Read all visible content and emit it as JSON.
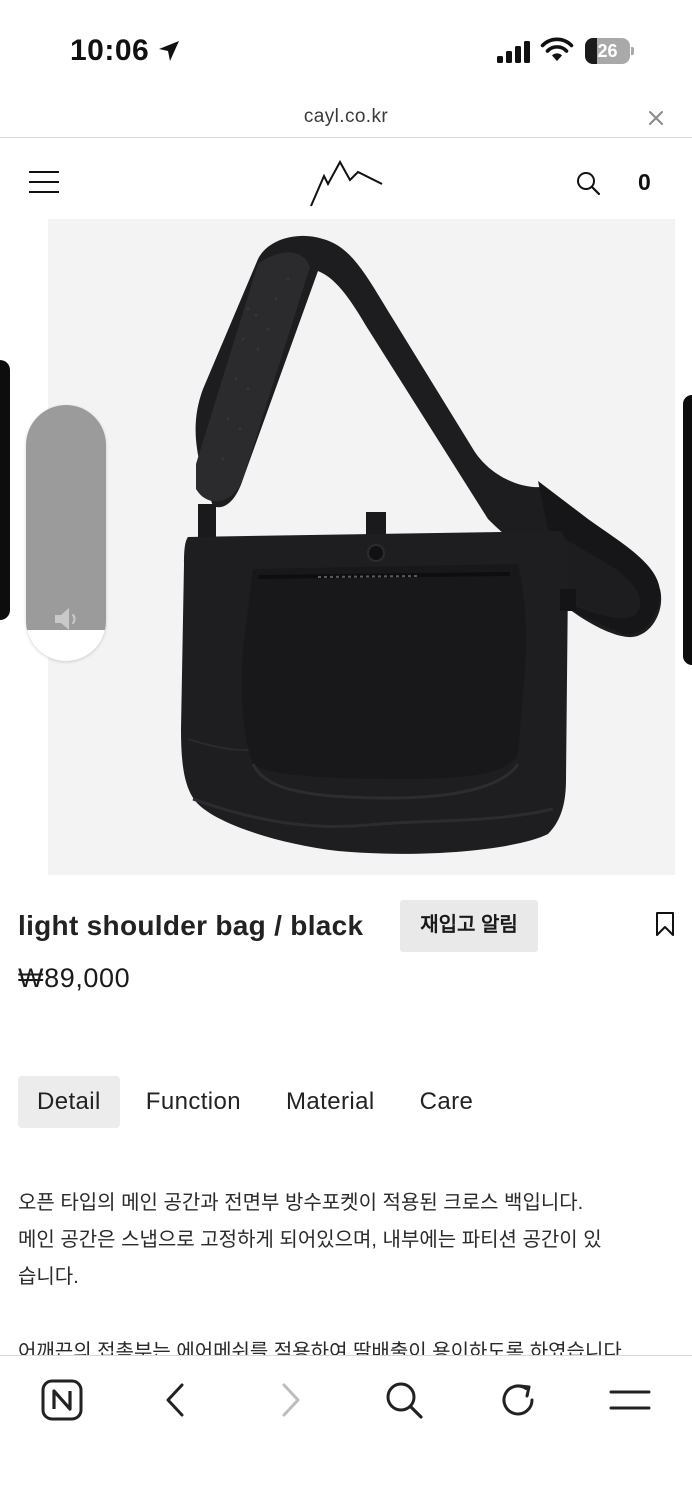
{
  "status_bar": {
    "time": "10:06",
    "battery": "26",
    "battery_level": 0.26
  },
  "url_bar": {
    "url": "cayl.co.kr"
  },
  "header": {
    "cart_count": "0"
  },
  "product": {
    "title": "light shoulder bag / black",
    "price": "₩89,000",
    "restock_button": "재입고 알림",
    "image_count": 11,
    "active_image_index": 0
  },
  "volume": {
    "level": 0.12
  },
  "tabs": [
    {
      "label": "Detail",
      "active": true
    },
    {
      "label": "Function",
      "active": false
    },
    {
      "label": "Material",
      "active": false
    },
    {
      "label": "Care",
      "active": false
    }
  ],
  "description": {
    "lines": [
      "오픈 타입의 메인 공간과 전면부 방수포켓이 적용된 크로스 백입니다.",
      "메인 공간은 스냅으로 고정하게 되어있으며, 내부에는 파티션 공간이 있",
      "습니다."
    ],
    "line_after_gap": "어깨끈의 접촉부는 에어메쉬를 적용하여 땀배출이 용이하도록 하였습니다."
  },
  "colors": {
    "accent": "#111111",
    "tab_active_bg": "#ececec",
    "button_bg": "#e9e9e9",
    "image_bg": "#f3f3f4"
  },
  "toolbar": {
    "icons": [
      "naver-n-icon",
      "back-icon",
      "forward-icon",
      "search-icon",
      "reload-icon",
      "menu-icon"
    ]
  }
}
